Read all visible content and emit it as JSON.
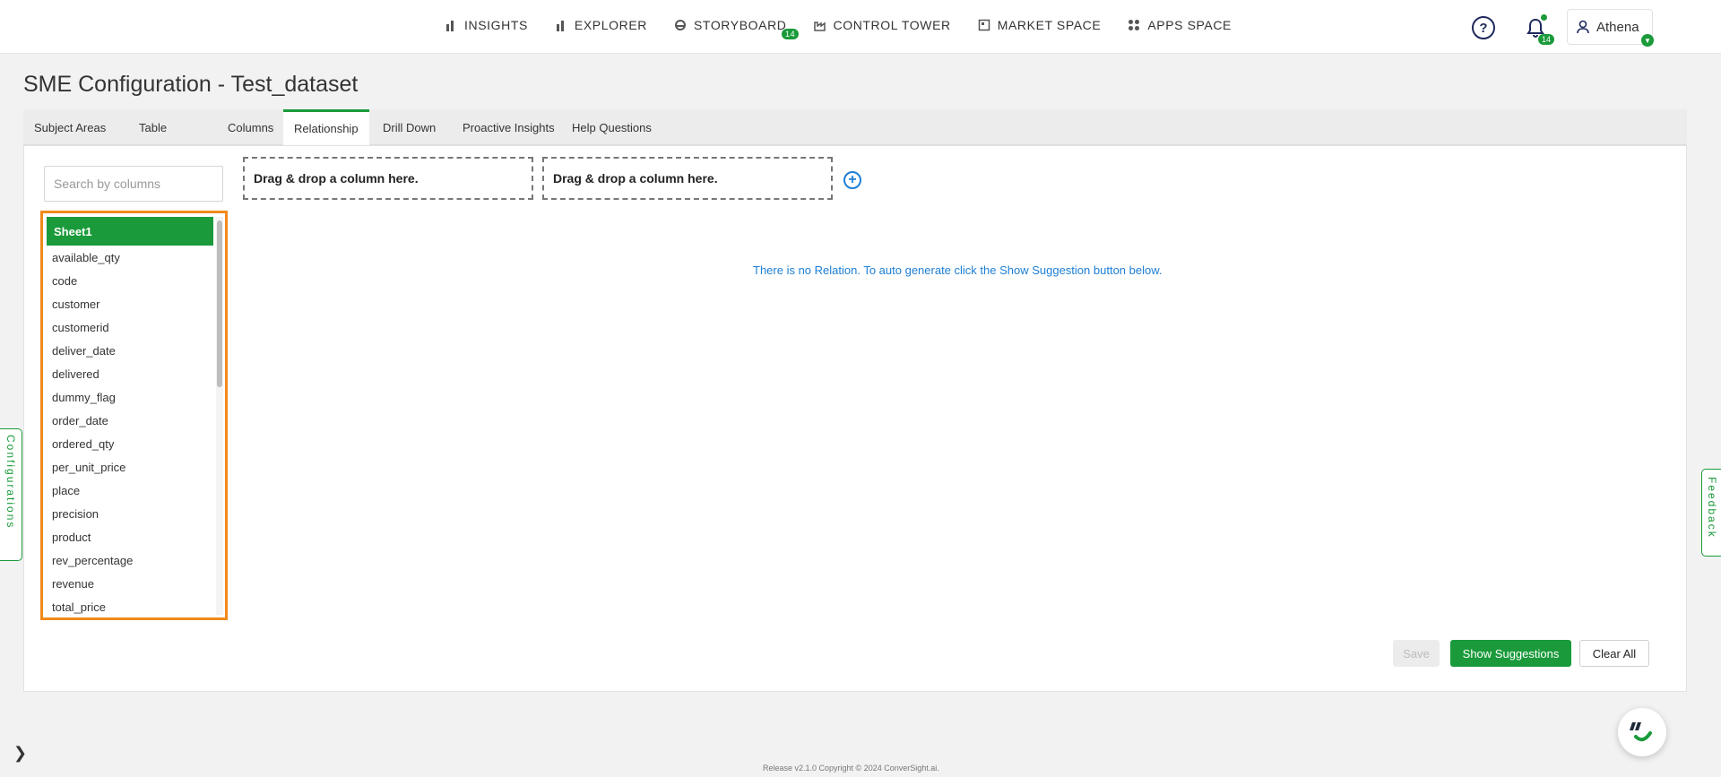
{
  "nav": {
    "items": [
      {
        "label": "INSIGHTS",
        "icon": "bar-chart-icon"
      },
      {
        "label": "EXPLORER",
        "icon": "bar-chart-icon"
      },
      {
        "label": "STORYBOARD",
        "icon": "storyboard-icon",
        "badge": "14"
      },
      {
        "label": "CONTROL TOWER",
        "icon": "factory-icon"
      },
      {
        "label": "MARKET SPACE",
        "icon": "market-icon"
      },
      {
        "label": "APPS SPACE",
        "icon": "grid-icon"
      }
    ]
  },
  "header": {
    "help_icon": "?",
    "notifications_badge": "14",
    "user_name": "Athena"
  },
  "page": {
    "title": "SME Configuration - Test_dataset"
  },
  "tabs": [
    {
      "label": "Subject Areas"
    },
    {
      "label": "Table"
    },
    {
      "label": "Columns"
    },
    {
      "label": "Relationship",
      "active": true
    },
    {
      "label": "Drill Down"
    },
    {
      "label": "Proactive Insights"
    },
    {
      "label": "Help Questions"
    }
  ],
  "search": {
    "placeholder": "Search by columns"
  },
  "column_list": {
    "sheet": "Sheet1",
    "columns": [
      "available_qty",
      "code",
      "customer",
      "customerid",
      "deliver_date",
      "delivered",
      "dummy_flag",
      "order_date",
      "ordered_qty",
      "per_unit_price",
      "place",
      "precision",
      "product",
      "rev_percentage",
      "revenue",
      "total_price"
    ]
  },
  "drop_zones": [
    "Drag & drop a column here.",
    "Drag & drop a column here."
  ],
  "info_message": "There is no Relation. To auto generate click the Show Suggestion button below.",
  "actions": {
    "save": "Save",
    "show_suggestions": "Show Suggestions",
    "clear_all": "Clear All"
  },
  "side_tabs": {
    "left": "Configurations",
    "right": "Feedback"
  },
  "footer": "Release v2.1.0 Copyright © 2024 ConverSight.ai.",
  "colors": {
    "accent": "#1a9a3a",
    "link": "#1e7fd6",
    "highlight": "#f08a1c"
  }
}
